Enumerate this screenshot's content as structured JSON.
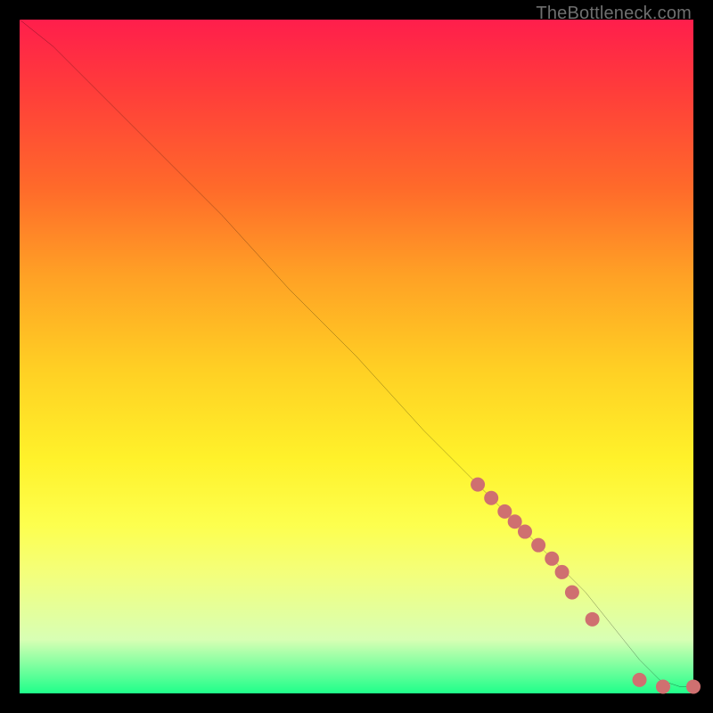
{
  "watermark": "TheBottleneck.com",
  "chart_data": {
    "type": "line",
    "title": "",
    "xlabel": "",
    "ylabel": "",
    "xlim": [
      0,
      100
    ],
    "ylim": [
      0,
      100
    ],
    "grid": false,
    "series": [
      {
        "name": "curve",
        "color": "#000000",
        "x": [
          0,
          5,
          10,
          15,
          20,
          30,
          40,
          50,
          60,
          68,
          72,
          76,
          80,
          84,
          88,
          92,
          95,
          98,
          100
        ],
        "y": [
          100,
          96,
          91,
          86,
          81,
          71,
          60,
          50,
          39,
          31,
          27,
          23,
          19,
          15,
          10,
          5,
          2,
          1,
          1
        ]
      }
    ],
    "markers": {
      "name": "points",
      "color": "#cf7070",
      "radius_px": 8,
      "x": [
        68,
        70,
        72,
        73.5,
        75,
        77,
        79,
        80.5,
        82,
        85,
        92,
        95.5,
        100
      ],
      "y": [
        31,
        29,
        27,
        25.5,
        24,
        22,
        20,
        18,
        15,
        11,
        2,
        1,
        1
      ]
    },
    "background_gradient": [
      "#ff1e4c",
      "#ff6a2a",
      "#ffd024",
      "#fdff4e",
      "#1fff8a"
    ]
  }
}
